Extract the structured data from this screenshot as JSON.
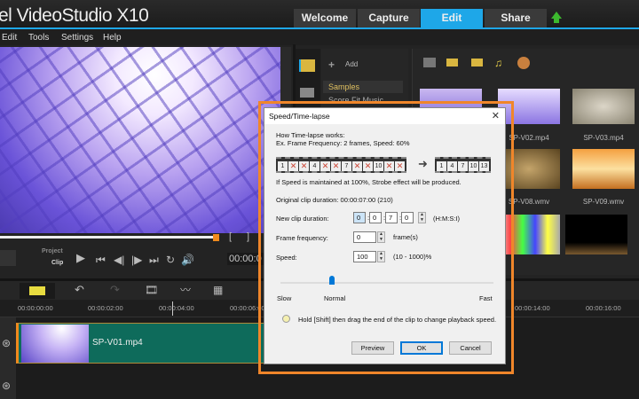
{
  "app": {
    "title": "el VideoStudio X10"
  },
  "tabs": [
    {
      "label": "Welcome"
    },
    {
      "label": "Capture"
    },
    {
      "label": "Edit",
      "active": true
    },
    {
      "label": "Share"
    }
  ],
  "menu": [
    "Edit",
    "Tools",
    "Settings",
    "Help"
  ],
  "player": {
    "project_label": "Project",
    "clip_label": "Clip",
    "timecode": "00:00:0"
  },
  "library": {
    "add_label": "Add",
    "folders": [
      "Samples",
      "Score Fit Music"
    ],
    "thumbnails": [
      {
        "label": ""
      },
      {
        "label": "SP-V02.mp4"
      },
      {
        "label": "SP-V03.mp4"
      },
      {
        "label": ""
      },
      {
        "label": "SP-V08.wmv"
      },
      {
        "label": "SP-V09.wmv"
      },
      {
        "label": ""
      },
      {
        "label": ""
      },
      {
        "label": ""
      }
    ]
  },
  "timeline": {
    "ruler": [
      "00:00:00:00",
      "00:00:02:00",
      "00:00:04:00",
      "00:00:06:00",
      "00:00:14:00",
      "00:00:16:00"
    ],
    "clip_name": "SP-V01.mp4"
  },
  "dialog": {
    "title": "Speed/Time-lapse",
    "how_title": "How Time-lapse works:",
    "example": "Ex. Frame Frequency: 2 frames, Speed: 60%",
    "film_in": [
      "1",
      "x",
      "x",
      "4",
      "x",
      "x",
      "7",
      "x",
      "x",
      "10",
      "x",
      "x"
    ],
    "film_out": [
      "1",
      "4",
      "7",
      "10",
      "13"
    ],
    "strobe_note": "If Speed is maintained at 100%, Strobe effect will be produced.",
    "original_duration": "Original clip duration: 00:00:07:00 (210)",
    "new_duration_label": "New clip duration:",
    "duration": {
      "h": "0",
      "m": "0",
      "s": "7",
      "i": "0"
    },
    "duration_format": "(H:M:S:I)",
    "frame_freq_label": "Frame frequency:",
    "frame_freq": "0",
    "frame_unit": "frame(s)",
    "speed_label": "Speed:",
    "speed": "100",
    "speed_range": "(10 - 1000)%",
    "slider": {
      "slow": "Slow",
      "normal": "Normal",
      "fast": "Fast",
      "value_percent": 100
    },
    "hint": "Hold [Shift] then drag the end of the clip to change playback speed.",
    "buttons": {
      "preview": "Preview",
      "ok": "OK",
      "cancel": "Cancel"
    },
    "highlight_color": "#f0862a"
  }
}
